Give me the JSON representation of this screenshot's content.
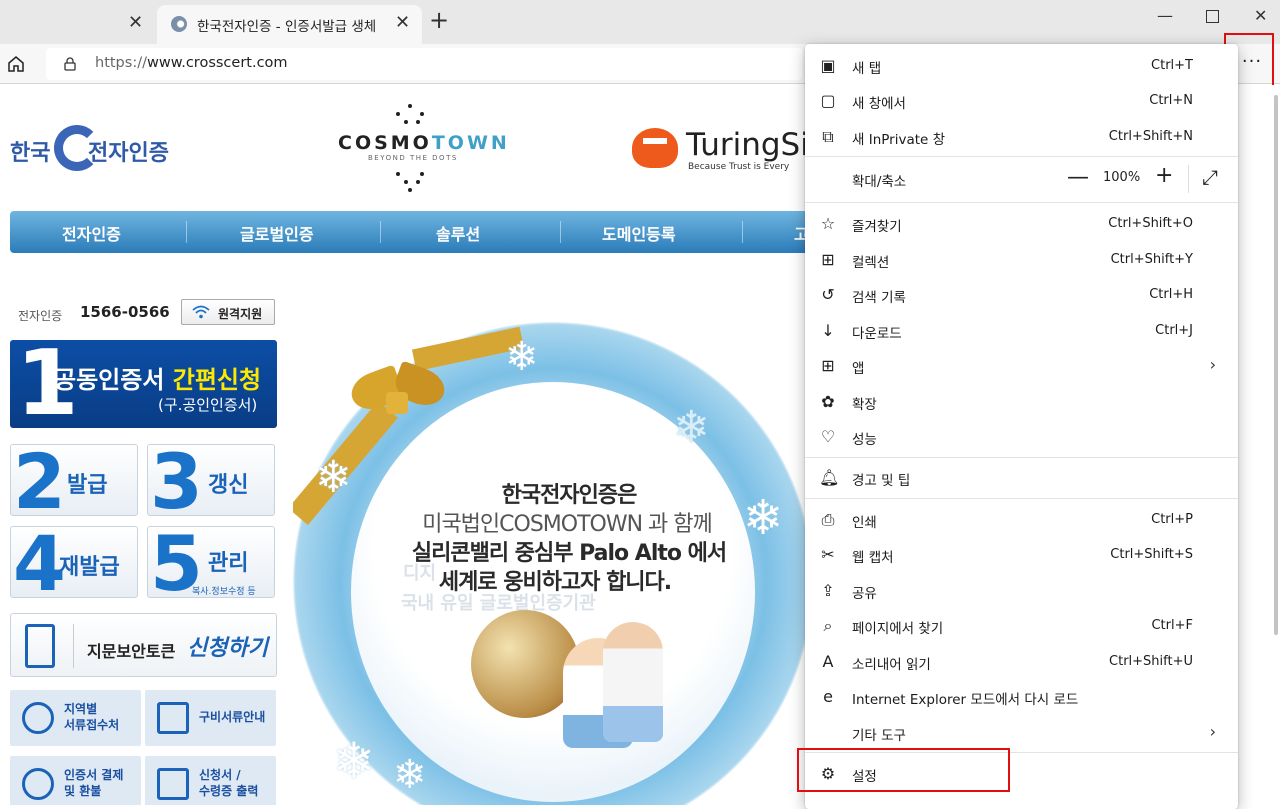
{
  "browser": {
    "tabs": [
      {
        "title": ""
      },
      {
        "title": "한국전자인증 - 인증서발급 생체"
      }
    ],
    "url_scheme": "https://",
    "url_host": "www.crosscert.com",
    "more_label": "···"
  },
  "page": {
    "logos": {
      "crosscert_left": "한국",
      "crosscert_right": "전자인증",
      "cosmotown_a": "COSMO",
      "cosmotown_b": "TOWN",
      "cosmotown_sub": "BEYOND THE DOTS",
      "turing_name": "TuringSig",
      "turing_tag": "Because Trust is Every"
    },
    "nav": [
      "전자인증",
      "글로벌인증",
      "솔루션",
      "도메인등록",
      "고"
    ],
    "phone_label": "전자인증",
    "phone_number": "1566-0566",
    "remote_label": "원격지원",
    "main_cta": {
      "number": "1",
      "text": "공동인증서 ",
      "highlight": "간편신청",
      "sub": "(구.공인인증서)"
    },
    "tiles": [
      {
        "number": "2",
        "label": "발급",
        "sub": ""
      },
      {
        "number": "3",
        "label": "갱신",
        "sub": ""
      },
      {
        "number": "4",
        "label": "재발급",
        "sub": ""
      },
      {
        "number": "5",
        "label": "관리",
        "sub": "복사.정보수정 등"
      }
    ],
    "finger": {
      "text": "지문보안토큰",
      "highlight": "신청하기"
    },
    "small_buttons": [
      {
        "line1": "지역별",
        "line2": "서류접수처"
      },
      {
        "line1": "구비서류안내",
        "line2": ""
      },
      {
        "line1": "인증서 결제",
        "line2": "및 환불"
      },
      {
        "line1": "신청서 /",
        "line2": "수령증 출력"
      }
    ],
    "banner": {
      "line1": "한국전자인증은",
      "line2": "미국법인COSMOTOWN 과 함께",
      "line3": "실리콘밸리 중심부 Palo Alto 에서",
      "line4": "세계로 웅비하고자 합니다.",
      "faded1": "디지",
      "faded2": "국내 유일 글로벌인증기관"
    }
  },
  "menu": {
    "items": [
      {
        "icon": "new-tab-icon",
        "glyph": "▣",
        "label": "새 탭",
        "shortcut": "Ctrl+T"
      },
      {
        "icon": "new-window-icon",
        "glyph": "▢",
        "label": "새 창에서",
        "shortcut": "Ctrl+N"
      },
      {
        "icon": "inprivate-icon",
        "glyph": "⧉",
        "label": "새 InPrivate 창",
        "shortcut": "Ctrl+Shift+N"
      },
      {
        "icon": "favorites-icon",
        "glyph": "☆",
        "label": "즐겨찾기",
        "shortcut": "Ctrl+Shift+O"
      },
      {
        "icon": "collections-icon",
        "glyph": "⊞",
        "label": "컬렉션",
        "shortcut": "Ctrl+Shift+Y"
      },
      {
        "icon": "history-icon",
        "glyph": "↺",
        "label": "검색 기록",
        "shortcut": "Ctrl+H"
      },
      {
        "icon": "download-icon",
        "glyph": "↓",
        "label": "다운로드",
        "shortcut": "Ctrl+J"
      },
      {
        "icon": "apps-icon",
        "glyph": "⊞",
        "label": "앱",
        "shortcut": ""
      },
      {
        "icon": "extensions-icon",
        "glyph": "✿",
        "label": "확장",
        "shortcut": ""
      },
      {
        "icon": "performance-icon",
        "glyph": "♡",
        "label": "성능",
        "shortcut": ""
      },
      {
        "icon": "bell-icon",
        "glyph": "🔔︎",
        "label": "경고 및 팁",
        "shortcut": ""
      },
      {
        "icon": "print-icon",
        "glyph": "⎙",
        "label": "인쇄",
        "shortcut": "Ctrl+P"
      },
      {
        "icon": "web-capture-icon",
        "glyph": "✂",
        "label": "웹 캡처",
        "shortcut": "Ctrl+Shift+S"
      },
      {
        "icon": "share-icon",
        "glyph": "⇪",
        "label": "공유",
        "shortcut": ""
      },
      {
        "icon": "find-icon",
        "glyph": "⌕",
        "label": "페이지에서 찾기",
        "shortcut": "Ctrl+F"
      },
      {
        "icon": "read-aloud-icon",
        "glyph": "A",
        "label": "소리내어 읽기",
        "shortcut": "Ctrl+Shift+U"
      },
      {
        "icon": "ie-mode-icon",
        "glyph": "e",
        "label": "Internet Explorer 모드에서 다시 로드",
        "shortcut": ""
      },
      {
        "icon": "",
        "glyph": "",
        "label": "기타 도구",
        "shortcut": ""
      },
      {
        "icon": "settings-icon",
        "glyph": "⚙",
        "label": "설정",
        "shortcut": ""
      }
    ],
    "zoom": {
      "label": "확대/축소",
      "minus": "—",
      "value": "100%",
      "plus": "+",
      "fullscreen": "⤢"
    },
    "submenu_arrow": "›"
  }
}
